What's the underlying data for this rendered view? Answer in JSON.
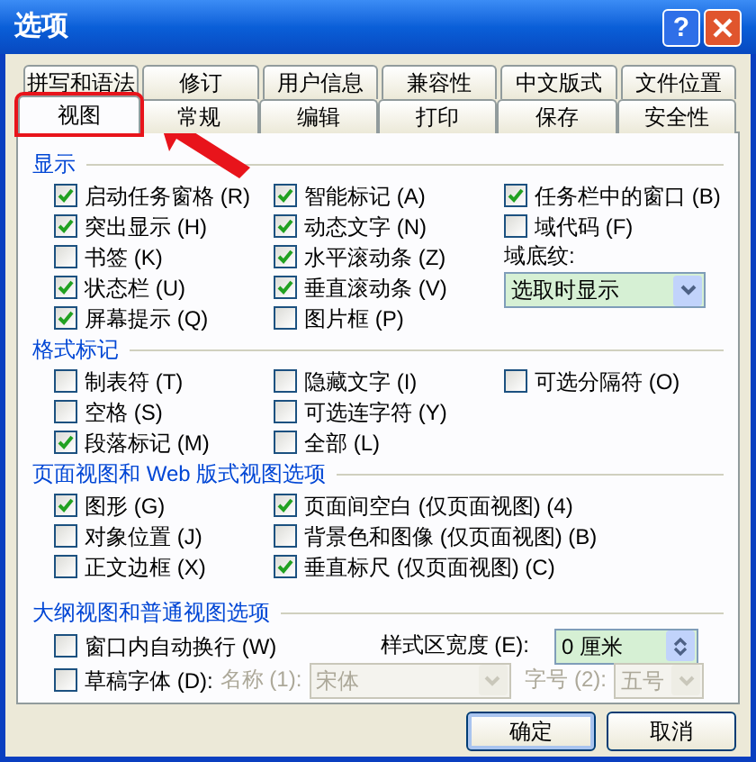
{
  "window": {
    "title": "选项",
    "help_button": "?"
  },
  "tabs_back_row": [
    {
      "label": "拼写和语法",
      "selected": false,
      "highlighted": false
    },
    {
      "label": "修订",
      "selected": false,
      "highlighted": false
    },
    {
      "label": "用户信息",
      "selected": false,
      "highlighted": false
    },
    {
      "label": "兼容性",
      "selected": false,
      "highlighted": false
    },
    {
      "label": "中文版式",
      "selected": false,
      "highlighted": false
    },
    {
      "label": "文件位置",
      "selected": false,
      "highlighted": false
    }
  ],
  "tabs_front_row": [
    {
      "label": "视图",
      "selected": true,
      "highlighted": true
    },
    {
      "label": "常规",
      "selected": false,
      "highlighted": false
    },
    {
      "label": "编辑",
      "selected": false,
      "highlighted": false
    },
    {
      "label": "打印",
      "selected": false,
      "highlighted": false
    },
    {
      "label": "保存",
      "selected": false,
      "highlighted": false
    },
    {
      "label": "安全性",
      "selected": false,
      "highlighted": false
    }
  ],
  "sections": [
    {
      "title": "显示",
      "columns": [
        [
          {
            "kind": "checkbox",
            "label": "启动任务窗格 (R)",
            "checked": true
          },
          {
            "kind": "checkbox",
            "label": "突出显示 (H)",
            "checked": true
          },
          {
            "kind": "checkbox",
            "label": "书签 (K)",
            "checked": false
          },
          {
            "kind": "checkbox",
            "label": "状态栏 (U)",
            "checked": true
          },
          {
            "kind": "checkbox",
            "label": "屏幕提示 (Q)",
            "checked": true
          }
        ],
        [
          {
            "kind": "checkbox",
            "label": "智能标记 (A)",
            "checked": true
          },
          {
            "kind": "checkbox",
            "label": "动态文字 (N)",
            "checked": true
          },
          {
            "kind": "checkbox",
            "label": "水平滚动条 (Z)",
            "checked": true
          },
          {
            "kind": "checkbox",
            "label": "垂直滚动条 (V)",
            "checked": true
          },
          {
            "kind": "checkbox",
            "label": "图片框 (P)",
            "checked": false
          }
        ],
        [
          {
            "kind": "checkbox",
            "label": "任务栏中的窗口 (B)",
            "checked": true
          },
          {
            "kind": "checkbox",
            "label": "域代码 (F)",
            "checked": false
          },
          {
            "kind": "label",
            "label": "域底纹:"
          },
          {
            "kind": "select",
            "value": "选取时显示"
          }
        ]
      ]
    },
    {
      "title": "格式标记",
      "columns": [
        [
          {
            "kind": "checkbox",
            "label": "制表符 (T)",
            "checked": false
          },
          {
            "kind": "checkbox",
            "label": "空格 (S)",
            "checked": false
          },
          {
            "kind": "checkbox",
            "label": "段落标记 (M)",
            "checked": true
          }
        ],
        [
          {
            "kind": "checkbox",
            "label": "隐藏文字 (I)",
            "checked": false
          },
          {
            "kind": "checkbox",
            "label": "可选连字符 (Y)",
            "checked": false
          },
          {
            "kind": "checkbox",
            "label": "全部 (L)",
            "checked": false
          }
        ],
        [
          {
            "kind": "checkbox",
            "label": "可选分隔符 (O)",
            "checked": false
          }
        ]
      ]
    },
    {
      "title": "页面视图和 Web 版式视图选项",
      "columns": [
        [
          {
            "kind": "checkbox",
            "label": "图形 (G)",
            "checked": true
          },
          {
            "kind": "checkbox",
            "label": "对象位置 (J)",
            "checked": false
          },
          {
            "kind": "checkbox",
            "label": "正文边框 (X)",
            "checked": false
          }
        ],
        [
          {
            "kind": "checkbox",
            "label": "页面间空白 (仅页面视图) (4)",
            "checked": true
          },
          {
            "kind": "checkbox",
            "label": "背景色和图像 (仅页面视图) (B)",
            "checked": false
          },
          {
            "kind": "checkbox",
            "label": "垂直标尺 (仅页面视图) (C)",
            "checked": true
          }
        ]
      ]
    }
  ],
  "outline_section": {
    "title": "大纲视图和普通视图选项",
    "wrap_window": {
      "label": "窗口内自动换行 (W)",
      "checked": false
    },
    "style_area_width": {
      "label": "样式区宽度 (E):",
      "value": "0 厘米"
    },
    "draft_font": {
      "label": "草稿字体 (D):",
      "checked": false
    },
    "font_name": {
      "label": "名称 (1):",
      "value": "宋体",
      "disabled": true
    },
    "font_size": {
      "label": "字号 (2):",
      "value": "五号",
      "disabled": true
    }
  },
  "buttons": [
    {
      "label": "确定",
      "default": true
    },
    {
      "label": "取消",
      "default": false
    }
  ]
}
